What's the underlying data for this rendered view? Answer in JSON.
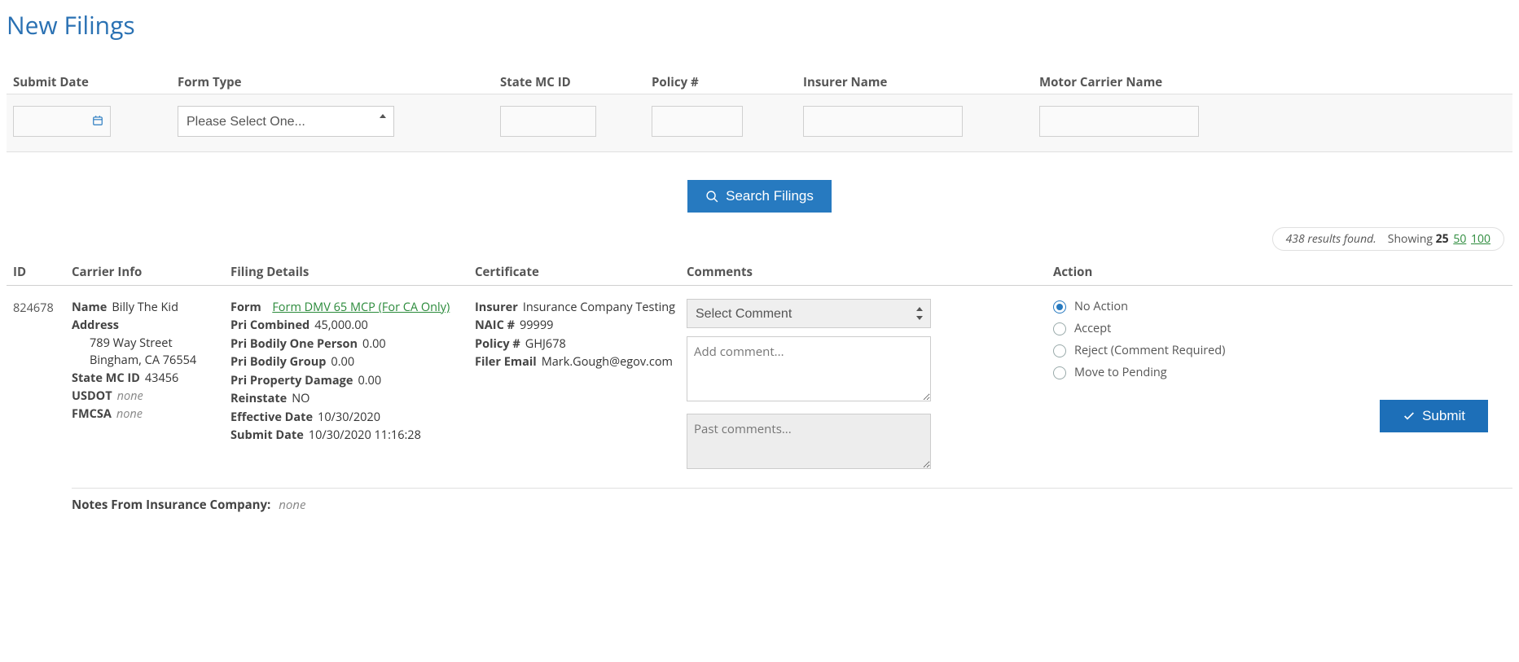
{
  "pageTitle": "New Filings",
  "filters": {
    "submitDateLabel": "Submit Date",
    "formTypeLabel": "Form Type",
    "formTypePlaceholder": "Please Select One...",
    "stateMcIdLabel": "State MC ID",
    "policyLabel": "Policy #",
    "insurerLabel": "Insurer Name",
    "carrierLabel": "Motor Carrier Name"
  },
  "searchButton": "Search Filings",
  "results": {
    "foundText": "438 results found.",
    "showingLabel": "Showing",
    "pageSizes": {
      "active": "25",
      "opt2": "50",
      "opt3": "100"
    }
  },
  "columns": {
    "id": "ID",
    "carrier": "Carrier Info",
    "filing": "Filing Details",
    "cert": "Certificate",
    "comments": "Comments",
    "action": "Action"
  },
  "row": {
    "id": "824678",
    "carrier": {
      "nameLabel": "Name",
      "name": "Billy The Kid",
      "addressLabel": "Address",
      "addr1": "789 Way Street",
      "addr2": "Bingham, CA 76554",
      "stateMcIdLabel": "State MC ID",
      "stateMcId": "43456",
      "usdotLabel": "USDOT",
      "usdot": "none",
      "fmcsaLabel": "FMCSA",
      "fmcsa": "none"
    },
    "filing": {
      "formLabel": "Form",
      "formLink": "Form DMV 65 MCP (For CA Only)",
      "priCombinedLabel": "Pri Combined",
      "priCombined": "45,000.00",
      "priBodilyOneLabel": "Pri Bodily One Person",
      "priBodilyOne": "0.00",
      "priBodilyGroupLabel": "Pri Bodily Group",
      "priBodilyGroup": "0.00",
      "priPropDamageLabel": "Pri Property Damage",
      "priPropDamage": "0.00",
      "reinstateLabel": "Reinstate",
      "reinstate": "NO",
      "effDateLabel": "Effective Date",
      "effDate": "10/30/2020",
      "submitDateLabel": "Submit Date",
      "submitDate": "10/30/2020 11:16:28"
    },
    "cert": {
      "insurerLabel": "Insurer",
      "insurer": "Insurance Company Testing",
      "naicLabel": "NAIC #",
      "naic": "99999",
      "policyLabel": "Policy #",
      "policy": "GHJ678",
      "filerLabel": "Filer Email",
      "filer": "Mark.Gough@egov.com"
    },
    "comments": {
      "selectPlaceholder": "Select Comment",
      "addPlaceholder": "Add comment...",
      "pastPlaceholder": "Past comments..."
    },
    "action": {
      "noAction": "No Action",
      "accept": "Accept",
      "reject": "Reject (Comment Required)",
      "pending": "Move to Pending",
      "submit": "Submit"
    },
    "notesLabel": "Notes From Insurance Company:",
    "notesValue": "none"
  }
}
